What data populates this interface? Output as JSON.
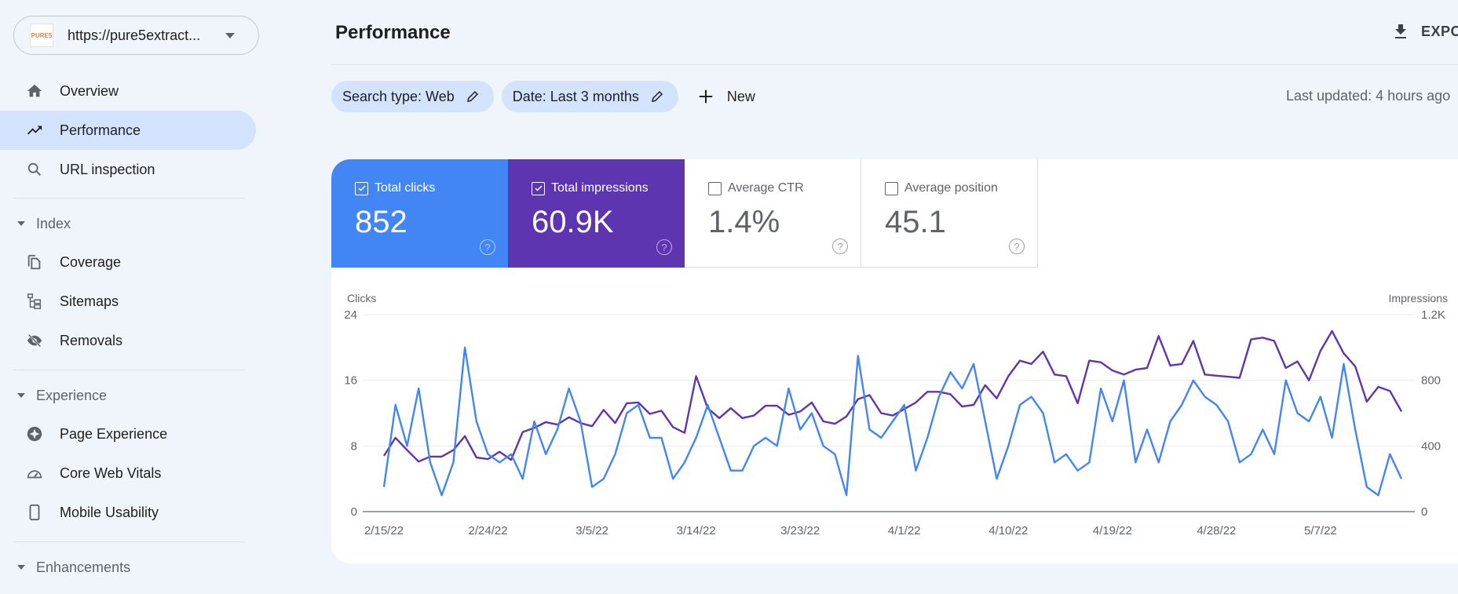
{
  "sidebar": {
    "property": {
      "logo_text": "PURE5",
      "url": "https://pure5extract..."
    },
    "items": [
      {
        "label": "Overview",
        "icon": "home-icon"
      },
      {
        "label": "Performance",
        "icon": "trending-up-icon",
        "active": true
      },
      {
        "label": "URL inspection",
        "icon": "search-icon"
      }
    ],
    "sections": [
      {
        "label": "Index",
        "items": [
          {
            "label": "Coverage",
            "icon": "copy-pages-icon"
          },
          {
            "label": "Sitemaps",
            "icon": "sitemap-icon"
          },
          {
            "label": "Removals",
            "icon": "eye-off-icon"
          }
        ]
      },
      {
        "label": "Experience",
        "items": [
          {
            "label": "Page Experience",
            "icon": "page-experience-icon"
          },
          {
            "label": "Core Web Vitals",
            "icon": "speedometer-icon"
          },
          {
            "label": "Mobile Usability",
            "icon": "phone-icon"
          }
        ]
      },
      {
        "label": "Enhancements",
        "items": []
      }
    ]
  },
  "header": {
    "title": "Performance",
    "export_label": "EXPORT"
  },
  "filters": {
    "chips": [
      {
        "label": "Search type: Web"
      },
      {
        "label": "Date: Last 3 months"
      }
    ],
    "new_label": "New",
    "last_updated": "Last updated: 4 hours ago"
  },
  "metrics": [
    {
      "label": "Total clicks",
      "value": "852",
      "checked": true,
      "color": "#4285f4"
    },
    {
      "label": "Total impressions",
      "value": "60.9K",
      "checked": true,
      "color": "#5e35b1"
    },
    {
      "label": "Average CTR",
      "value": "1.4%",
      "checked": false
    },
    {
      "label": "Average position",
      "value": "45.1",
      "checked": false
    }
  ],
  "chart_data": {
    "type": "line",
    "title": "",
    "x_start": "2/15/22",
    "x_end": "5/14/22",
    "xticks": [
      "2/15/22",
      "2/24/22",
      "3/5/22",
      "3/14/22",
      "3/23/22",
      "4/1/22",
      "4/10/22",
      "4/19/22",
      "4/28/22",
      "5/7/22"
    ],
    "xtick_interval_days": 9,
    "y_left": {
      "label": "Clicks",
      "ticks": [
        "0",
        "8",
        "16",
        "24"
      ],
      "range": [
        0,
        24
      ]
    },
    "y_right": {
      "label": "Impressions",
      "ticks": [
        "0",
        "400",
        "800",
        "1.2K"
      ],
      "range": [
        0,
        1200
      ]
    },
    "grid": true,
    "series": [
      {
        "name": "Clicks",
        "axis": "left",
        "color": "#4285f4",
        "values": [
          3,
          13,
          8,
          15,
          6,
          2,
          6,
          20,
          11,
          7,
          6,
          7,
          4,
          11,
          7,
          10,
          15,
          11,
          3,
          4,
          7,
          12,
          13,
          9,
          9,
          4,
          6,
          9,
          13,
          9,
          5,
          5,
          8,
          9,
          8,
          15,
          10,
          12,
          8,
          7,
          2,
          19,
          10,
          9,
          11,
          13,
          5,
          9,
          14,
          17,
          15,
          18,
          11,
          4,
          8,
          13,
          14,
          12,
          6,
          7,
          5,
          6,
          15,
          11,
          16,
          6,
          10,
          6,
          11,
          13,
          16,
          14,
          13,
          11,
          6,
          7,
          10,
          7,
          16,
          12,
          11,
          14,
          9,
          18,
          10,
          3,
          2,
          7,
          4
        ]
      },
      {
        "name": "Impressions",
        "axis": "right",
        "color": "#5e35b1",
        "values": [
          340,
          450,
          375,
          305,
          335,
          335,
          375,
          460,
          330,
          320,
          365,
          315,
          485,
          510,
          545,
          530,
          575,
          540,
          520,
          620,
          540,
          660,
          665,
          595,
          615,
          515,
          480,
          825,
          630,
          570,
          630,
          570,
          585,
          645,
          645,
          590,
          610,
          665,
          550,
          535,
          580,
          685,
          710,
          600,
          585,
          625,
          665,
          730,
          730,
          715,
          640,
          650,
          770,
          690,
          825,
          920,
          900,
          975,
          835,
          825,
          660,
          920,
          910,
          860,
          835,
          865,
          875,
          1070,
          890,
          900,
          1040,
          835,
          828,
          822,
          815,
          1050,
          1060,
          1040,
          875,
          915,
          800,
          980,
          1100,
          965,
          885,
          670,
          760,
          735,
          610
        ]
      }
    ]
  }
}
